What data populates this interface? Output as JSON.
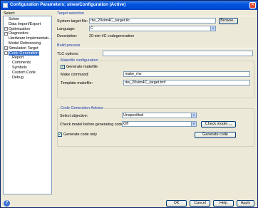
{
  "window": {
    "title": "Configuration Parameters: sines/Configuration (Active)",
    "close_glyph": "×"
  },
  "sidebar": {
    "select_label": "Select:",
    "items": [
      {
        "label": "Solver",
        "level": 0,
        "expander": ""
      },
      {
        "label": "Data Import/Export",
        "level": 0,
        "expander": ""
      },
      {
        "label": "Optimization",
        "level": 0,
        "expander": "+"
      },
      {
        "label": "Diagnostics",
        "level": 0,
        "expander": "+"
      },
      {
        "label": "Hardware Implementati...",
        "level": 0,
        "expander": ""
      },
      {
        "label": "Model Referencing",
        "level": 0,
        "expander": ""
      },
      {
        "label": "Simulation Target",
        "level": 0,
        "expander": "+"
      },
      {
        "label": "Code Generation",
        "level": 0,
        "expander": "-",
        "selected": true
      },
      {
        "label": "Report",
        "level": 1,
        "expander": ""
      },
      {
        "label": "Comments",
        "level": 1,
        "expander": ""
      },
      {
        "label": "Symbols",
        "level": 1,
        "expander": ""
      },
      {
        "label": "Custom Code",
        "level": 1,
        "expander": ""
      },
      {
        "label": "Debug",
        "level": 1,
        "expander": ""
      }
    ]
  },
  "target_selection": {
    "title": "Target selection",
    "system_target_label": "System target file:",
    "system_target_value": "rtw_20sim4C_target.tlc",
    "browse_label": "Browse...",
    "language_label": "Language:",
    "language_value": "C",
    "description_label": "Description:",
    "description_value": "20-sim 4C codegeneration"
  },
  "build_process": {
    "title": "Build process",
    "tlc_options_label": "TLC options:",
    "tlc_options_value": "",
    "makefile_group": "Makefile configuration",
    "generate_makefile_label": "Generate makefile",
    "generate_makefile_checked": true,
    "make_command_label": "Make command:",
    "make_command_value": "make_rtw",
    "template_makefile_label": "Template makefile:",
    "template_makefile_value": "rtw_20sim4C_target.tmf"
  },
  "advisor": {
    "group": "Code Generation Advisor",
    "objective_label": "Select objective:",
    "objective_value": "Unspecified",
    "check_model_label": "Check model before generating code:",
    "check_model_value": "Off",
    "check_model_button": "Check model ...",
    "generate_only_label": "Generate code only",
    "generate_only_checked": true,
    "generate_code_button": "Generate code"
  },
  "footer": {
    "ok": "OK",
    "cancel": "Cancel",
    "help": "Help",
    "apply": "Apply"
  },
  "icons": {
    "help": "?",
    "check": "✓",
    "dropdown": "▼",
    "grip": "⋰"
  },
  "colors": {
    "titlebar": "#0054e3",
    "section_title": "#1a3bb0",
    "selected": "#316ac5",
    "check": "#21a121"
  }
}
